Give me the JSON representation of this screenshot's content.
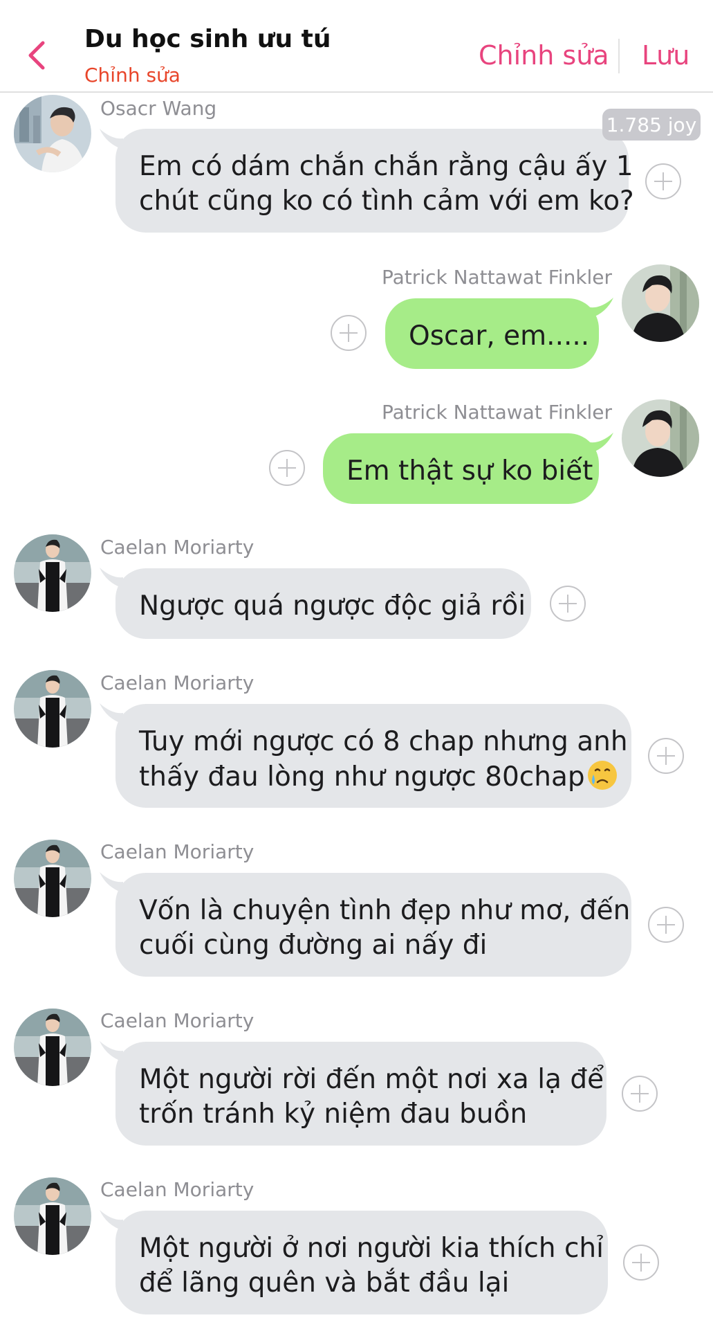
{
  "header": {
    "title": "Du học sinh ưu tú",
    "subtitle": "Chỉnh sửa",
    "edit_label": "Chỉnh sửa",
    "save_label": "Lưu",
    "accent_color": "#e8447e",
    "subtitle_color": "#e8452a"
  },
  "messages": [
    {
      "sender": "Osacr Wang",
      "side": "left",
      "lines": [
        "Em có dám chắn chắn rằng cậu ấy 1",
        "chút cũng ko có tình cảm với em ko?"
      ],
      "badge": "1.785 joy"
    },
    {
      "sender": "Patrick Nattawat Finkler",
      "side": "right",
      "lines": [
        "Oscar, em....."
      ]
    },
    {
      "sender": "Patrick Nattawat Finkler",
      "side": "right",
      "lines": [
        "Em thật sự ko biết"
      ]
    },
    {
      "sender": "Caelan Moriarty",
      "side": "left",
      "lines": [
        "Ngược quá ngược độc giả rồi"
      ]
    },
    {
      "sender": "Caelan Moriarty",
      "side": "left",
      "lines": [
        "Tuy mới ngược có 8 chap nhưng anh",
        "thấy đau lòng như ngược 80chap"
      ],
      "emoji": "crying-face-emoji"
    },
    {
      "sender": "Caelan Moriarty",
      "side": "left",
      "lines": [
        "Vốn là chuyện tình đẹp như mơ, đến",
        "cuối cùng đường ai nấy đi"
      ]
    },
    {
      "sender": "Caelan Moriarty",
      "side": "left",
      "lines": [
        "Một người rời đến một nơi xa lạ để",
        "trốn tránh kỷ niệm đau buồn"
      ]
    },
    {
      "sender": "Caelan Moriarty",
      "side": "left",
      "lines": [
        "Một người ở nơi người kia thích chỉ",
        "để lãng quên và bắt đầu lại"
      ]
    }
  ],
  "colors": {
    "bubble_gray": "#e4e6e9",
    "bubble_green": "#a6ec88",
    "sender_gray": "#8e8e93"
  },
  "icons": {
    "back": "chevron-left-icon",
    "add": "plus-circle-icon"
  }
}
